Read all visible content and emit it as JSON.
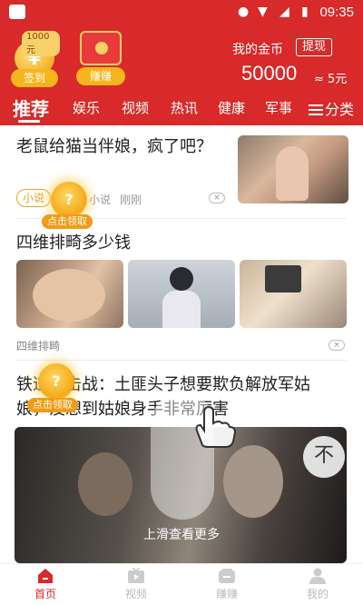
{
  "status_bar": {
    "time": "09:35"
  },
  "header": {
    "coin_badge": "1000元",
    "sign_in_label": "签到",
    "earn_label": "赚赚",
    "my_coins_title": "我的金币",
    "withdraw_label": "提现",
    "coin_amount": "50000",
    "coin_approx": "≈ 5元"
  },
  "tabs": {
    "items": [
      "推荐",
      "娱乐",
      "视频",
      "热讯",
      "健康",
      "军事"
    ],
    "category_label": "分类"
  },
  "articles": [
    {
      "title": "老鼠给猫当伴娘，疯了吧？",
      "tag": "小说",
      "source": "小说",
      "time": "刚刚",
      "close": "×"
    },
    {
      "title": "四维排畸多少钱",
      "source": "四维排畸",
      "close": "×"
    },
    {
      "title": "铁道游击战：土匪头子想要欺负解放军姑娘，没想到姑娘身手非常厉害"
    }
  ],
  "bubbles": [
    {
      "symbol": "?",
      "label": "点击领取"
    },
    {
      "symbol": "?",
      "label": "点击领取"
    }
  ],
  "swipe_hint": "上滑查看更多",
  "top_button_symbol": "不",
  "bottom_nav": {
    "items": [
      {
        "label": "首页",
        "icon": "home-icon",
        "active": true
      },
      {
        "label": "视频",
        "icon": "video-icon",
        "active": false
      },
      {
        "label": "赚赚",
        "icon": "earn-icon",
        "active": false
      },
      {
        "label": "我的",
        "icon": "profile-icon",
        "active": false
      }
    ]
  },
  "colors": {
    "brand": "#d82a2a",
    "coin": "#f5b51d"
  }
}
